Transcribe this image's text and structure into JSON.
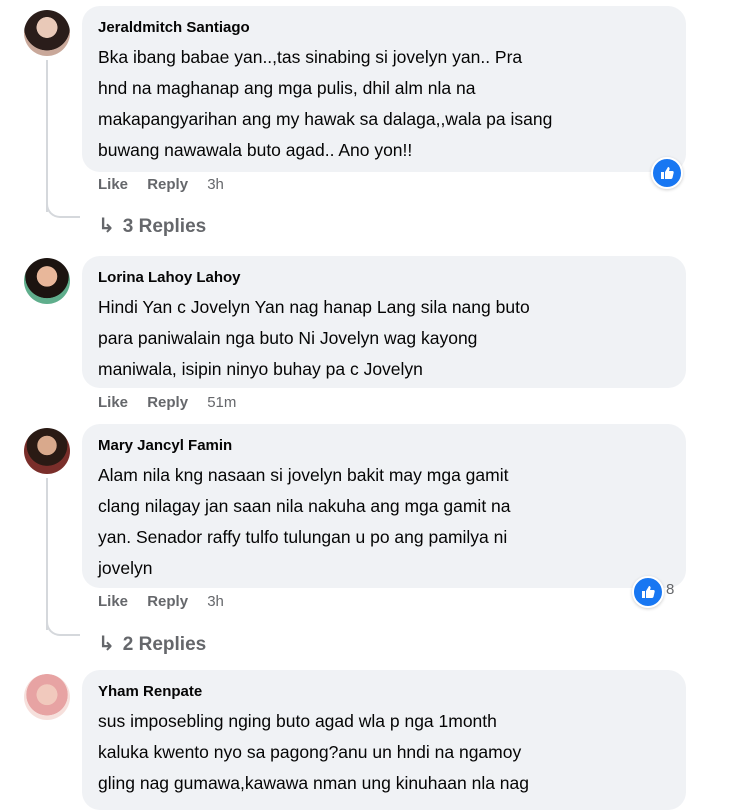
{
  "comments": [
    {
      "author": "Jeraldmitch Santiago",
      "lines": [
        "Bka ibang babae yan..,tas sinabing si jovelyn yan.. Pra",
        "hnd na maghanap ang mga pulis, dhil alm nla na",
        "makapangyarihan ang my hawak sa dalaga,,wala pa isang",
        "buwang nawawala buto agad.. Ano yon!!"
      ],
      "like": "Like",
      "reply": "Reply",
      "time": "3h",
      "replies": "3 Replies"
    },
    {
      "author": "Lorina Lahoy Lahoy",
      "lines": [
        "Hindi Yan c Jovelyn Yan nag hanap Lang sila nang buto",
        "para paniwalain nga buto Ni Jovelyn wag kayong",
        "maniwala, isipin ninyo buhay pa c Jovelyn"
      ],
      "like": "Like",
      "reply": "Reply",
      "time": "51m"
    },
    {
      "author": "Mary Jancyl Famin",
      "lines": [
        "Alam nila kng nasaan si jovelyn bakit may mga gamit",
        "clang nilagay jan saan nila nakuha ang mga gamit na",
        "yan. Senador raffy tulfo tulungan u po ang pamilya ni",
        "jovelyn"
      ],
      "like": "Like",
      "reply": "Reply",
      "time": "3h",
      "reaction_count": "8",
      "replies": "2 Replies"
    },
    {
      "author": "Yham Renpate",
      "lines": [
        "sus imposebling nging buto agad wla p nga 1month",
        "kaluka kwento nyo sa pagong?anu un hndi na ngamoy",
        "gling nag gumawa,kawawa nman ung kinuhaan nla nag"
      ]
    }
  ],
  "icons": {
    "like_reaction": "thumbs-up-icon",
    "reply_arrow": "reply-arrow-icon"
  },
  "colors": {
    "bubble": "#f0f2f5",
    "meta": "#65676b",
    "reaction": "#1877f2"
  }
}
